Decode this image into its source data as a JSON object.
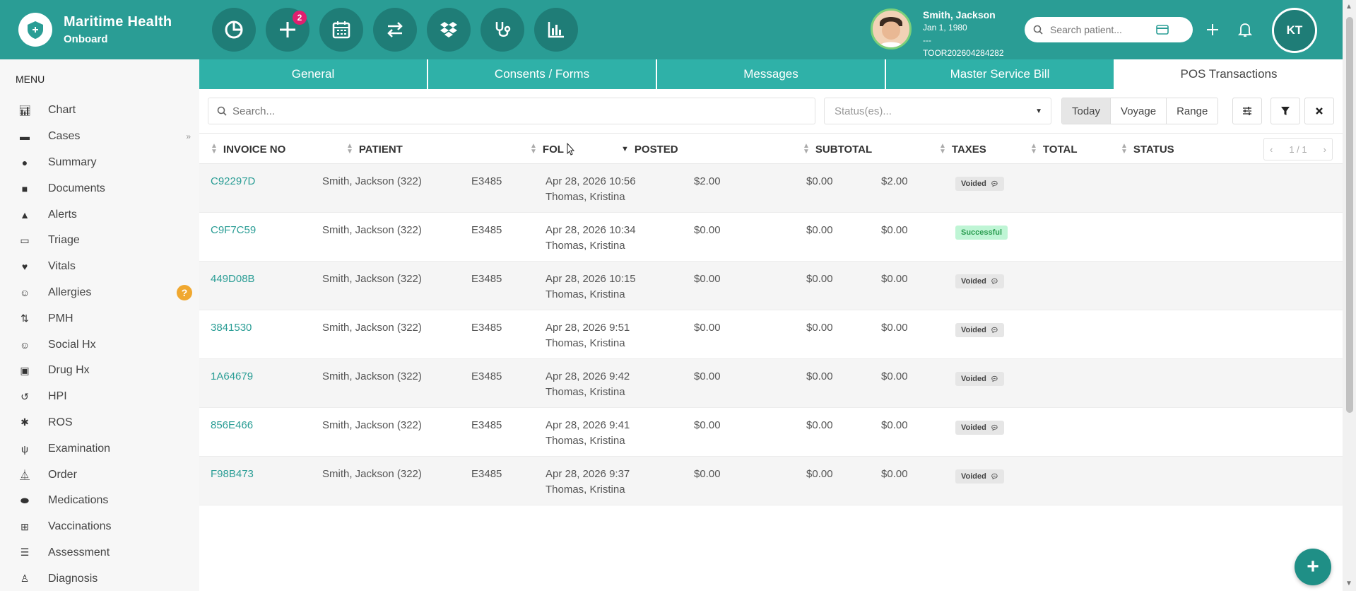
{
  "app": {
    "title": "Maritime Health",
    "subtitle": "Onboard"
  },
  "toolbar": {
    "buttons": [
      {
        "icon": "pie-chart-icon"
      },
      {
        "icon": "plus-icon",
        "badge": "2"
      },
      {
        "icon": "calendar-icon"
      },
      {
        "icon": "transfer-icon"
      },
      {
        "icon": "dropbox-icon"
      },
      {
        "icon": "stethoscope-icon"
      },
      {
        "icon": "bar-chart-icon"
      }
    ]
  },
  "patient": {
    "name": "Smith, Jackson",
    "dob": "Jan 1, 1980",
    "dash": "---",
    "id": "TOOR202604284282"
  },
  "search_patient": {
    "placeholder": "Search patient..."
  },
  "user": {
    "initials": "KT"
  },
  "sidebar": {
    "title": "MENU",
    "items": [
      {
        "label": "Chart",
        "icon": "chart-icon"
      },
      {
        "label": "Cases",
        "icon": "cases-icon",
        "extra": "»"
      },
      {
        "label": "Summary",
        "icon": "eye-icon"
      },
      {
        "label": "Documents",
        "icon": "folder-icon"
      },
      {
        "label": "Alerts",
        "icon": "warning-icon"
      },
      {
        "label": "Triage",
        "icon": "inbox-icon"
      },
      {
        "label": "Vitals",
        "icon": "heart-icon"
      },
      {
        "label": "Allergies",
        "icon": "smile-icon",
        "help": "?"
      },
      {
        "label": "PMH",
        "icon": "sort-icon"
      },
      {
        "label": "Social Hx",
        "icon": "smile-icon"
      },
      {
        "label": "Drug Hx",
        "icon": "medkit-icon"
      },
      {
        "label": "HPI",
        "icon": "history-icon"
      },
      {
        "label": "ROS",
        "icon": "cog-icon"
      },
      {
        "label": "Examination",
        "icon": "stethoscope-icon"
      },
      {
        "label": "Order",
        "icon": "flask-icon"
      },
      {
        "label": "Medications",
        "icon": "pill-icon"
      },
      {
        "label": "Vaccinations",
        "icon": "plus-square-icon"
      },
      {
        "label": "Assessment",
        "icon": "list-icon"
      },
      {
        "label": "Diagnosis",
        "icon": "user-md-icon"
      }
    ]
  },
  "tabs": [
    {
      "label": "General",
      "active": false
    },
    {
      "label": "Consents / Forms",
      "active": false
    },
    {
      "label": "Messages",
      "active": false
    },
    {
      "label": "Master Service Bill",
      "active": false
    },
    {
      "label": "POS Transactions",
      "active": true
    }
  ],
  "filters": {
    "search_placeholder": "Search...",
    "status_placeholder": "Status(es)...",
    "ranges": [
      "Today",
      "Voyage",
      "Range"
    ],
    "active_range": "Today"
  },
  "table": {
    "columns": [
      "INVOICE NO",
      "PATIENT",
      "FOLIO",
      "POSTED",
      "SUBTOTAL",
      "TAXES",
      "TOTAL",
      "STATUS"
    ],
    "folio_visible": "FOL",
    "pager": "1 / 1",
    "rows": [
      {
        "invoice": "C92297D",
        "patient": "Smith, Jackson (322)",
        "folio": "E3485",
        "posted": "Apr 28, 2026 10:56",
        "by": "Thomas, Kristina",
        "subtotal": "$2.00",
        "taxes": "$0.00",
        "total": "$2.00",
        "status": "Voided"
      },
      {
        "invoice": "C9F7C59",
        "patient": "Smith, Jackson (322)",
        "folio": "E3485",
        "posted": "Apr 28, 2026 10:34",
        "by": "Thomas, Kristina",
        "subtotal": "$0.00",
        "taxes": "$0.00",
        "total": "$0.00",
        "status": "Successful"
      },
      {
        "invoice": "449D08B",
        "patient": "Smith, Jackson (322)",
        "folio": "E3485",
        "posted": "Apr 28, 2026 10:15",
        "by": "Thomas, Kristina",
        "subtotal": "$0.00",
        "taxes": "$0.00",
        "total": "$0.00",
        "status": "Voided"
      },
      {
        "invoice": "3841530",
        "patient": "Smith, Jackson (322)",
        "folio": "E3485",
        "posted": "Apr 28, 2026 9:51",
        "by": "Thomas, Kristina",
        "subtotal": "$0.00",
        "taxes": "$0.00",
        "total": "$0.00",
        "status": "Voided"
      },
      {
        "invoice": "1A64679",
        "patient": "Smith, Jackson (322)",
        "folio": "E3485",
        "posted": "Apr 28, 2026 9:42",
        "by": "Thomas, Kristina",
        "subtotal": "$0.00",
        "taxes": "$0.00",
        "total": "$0.00",
        "status": "Voided"
      },
      {
        "invoice": "856E466",
        "patient": "Smith, Jackson (322)",
        "folio": "E3485",
        "posted": "Apr 28, 2026 9:41",
        "by": "Thomas, Kristina",
        "subtotal": "$0.00",
        "taxes": "$0.00",
        "total": "$0.00",
        "status": "Voided"
      },
      {
        "invoice": "F98B473",
        "patient": "Smith, Jackson (322)",
        "folio": "E3485",
        "posted": "Apr 28, 2026 9:37",
        "by": "Thomas, Kristina",
        "subtotal": "$0.00",
        "taxes": "$0.00",
        "total": "$0.00",
        "status": "Voided"
      }
    ]
  },
  "colors": {
    "brand": "#2a9d95",
    "brand_dark": "#1f7d77",
    "tab": "#2fb1a8",
    "badge": "#e01f6f",
    "success_bg": "#bff5d5"
  },
  "fab": {
    "label": "+"
  }
}
